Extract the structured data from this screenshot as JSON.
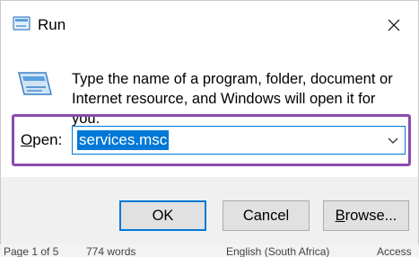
{
  "window": {
    "title": "Run",
    "icon": "run-icon",
    "close_icon": "close-icon"
  },
  "prompt": {
    "icon": "run-prompt-icon",
    "text": "Type the name of a program, folder, document or Internet resource, and Windows will open it for you."
  },
  "open": {
    "label_accel": "O",
    "label_rest": "pen:",
    "value": "services.msc",
    "dropdown_icon": "chevron-down-icon"
  },
  "buttons": {
    "ok": "OK",
    "cancel": "Cancel",
    "browse_accel": "B",
    "browse_rest": "rowse..."
  },
  "statusbar": {
    "page": "Page 1 of 5",
    "words": "774 words",
    "language": "English (South Africa)",
    "accessibility": "Access"
  },
  "colors": {
    "accent": "#0078d7",
    "highlight": "#8a4bb0"
  }
}
